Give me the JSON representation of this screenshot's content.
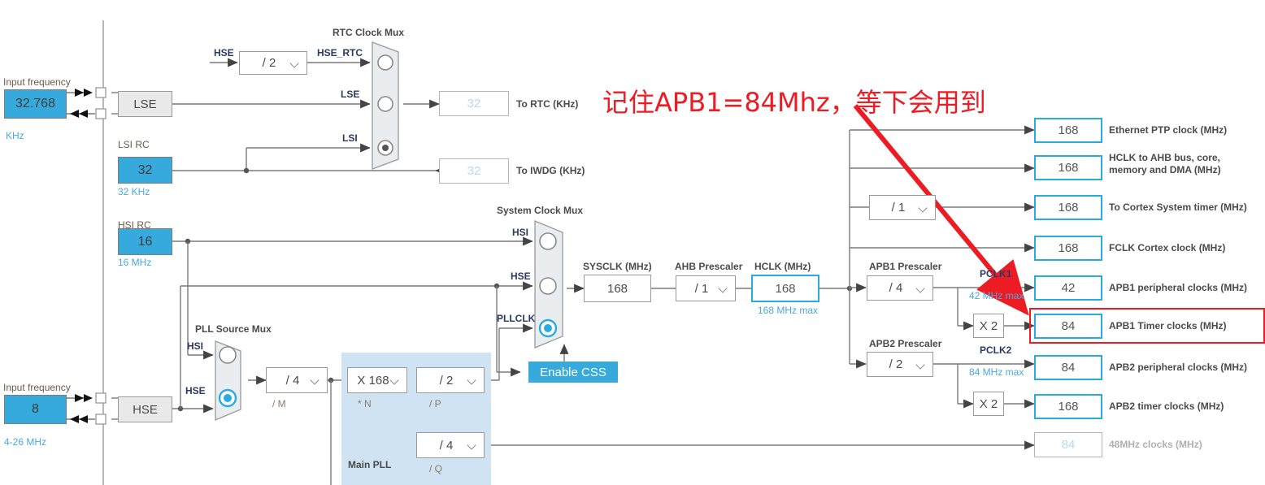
{
  "annotation": {
    "text": "记住APB1=84Mhz，等下会用到",
    "color": "#ED1C24"
  },
  "colors": {
    "accent_blue": "#29ABE2",
    "fill_blue": "#36A9DD",
    "pll_bg": "#cfe3f2",
    "red": "#ED1C24",
    "wire": "#7a7a7a"
  },
  "lse": {
    "input_caption": "Input frequency",
    "value": "32.768",
    "unit": "KHz",
    "osc_label": "LSE"
  },
  "lsi": {
    "caption": "LSI RC",
    "value": "32",
    "unit": "32 KHz"
  },
  "hsi": {
    "caption": "HSI RC",
    "value": "16",
    "unit": "16 MHz"
  },
  "hse": {
    "input_caption": "Input frequency",
    "value": "8",
    "unit": "4-26 MHz",
    "osc_label": "HSE"
  },
  "rtc_mux": {
    "title": "RTC Clock Mux",
    "inputs": [
      "HSE_RTC",
      "LSE",
      "LSI"
    ],
    "selected_index": 2,
    "hse_label": "HSE",
    "hse_div": "/ 2"
  },
  "rtc_outputs": [
    {
      "value": "32",
      "label": "To RTC (KHz)"
    },
    {
      "value": "32",
      "label": "To IWDG (KHz)"
    }
  ],
  "sysclk_mux": {
    "title": "System Clock Mux",
    "inputs": [
      "HSI",
      "HSE",
      "PLLCLK"
    ],
    "selected_index": 2,
    "css_button": "Enable CSS"
  },
  "pll_source_mux": {
    "title": "PLL Source Mux",
    "inputs": [
      "HSI",
      "HSE"
    ],
    "selected_index": 1
  },
  "pll": {
    "title": "Main PLL",
    "m": {
      "value": "/ 4",
      "label": "/ M"
    },
    "n": {
      "value": "X 168",
      "label": "* N"
    },
    "p": {
      "value": "/ 2",
      "label": "/ P"
    },
    "q": {
      "value": "/ 4",
      "label": "/ Q"
    }
  },
  "sysclk": {
    "label": "SYSCLK (MHz)",
    "value": "168"
  },
  "ahb_prescaler": {
    "label": "AHB Prescaler",
    "value": "/ 1"
  },
  "hclk": {
    "label": "HCLK (MHz)",
    "value": "168",
    "max": "168 MHz max"
  },
  "cortex_prescaler": {
    "value": "/ 1"
  },
  "apb1": {
    "label": "APB1 Prescaler",
    "value": "/ 4",
    "pclk_label": "PCLK1",
    "pclk_max": "42 MHz max",
    "timer_mult": "X 2"
  },
  "apb2": {
    "label": "APB2 Prescaler",
    "value": "/ 2",
    "pclk_label": "PCLK2",
    "pclk_max": "84 MHz max",
    "timer_mult": "X 2"
  },
  "outputs": [
    {
      "value": "168",
      "label": "Ethernet PTP clock (MHz)",
      "style": "blue",
      "highlight": false
    },
    {
      "value": "168",
      "label": "HCLK to AHB bus, core,\nmemory and DMA (MHz)",
      "style": "blue",
      "highlight": false
    },
    {
      "value": "168",
      "label": "To Cortex System timer (MHz)",
      "style": "blue",
      "highlight": false
    },
    {
      "value": "168",
      "label": "FCLK Cortex clock (MHz)",
      "style": "blue",
      "highlight": false
    },
    {
      "value": "42",
      "label": "APB1 peripheral clocks (MHz)",
      "style": "blue",
      "highlight": false
    },
    {
      "value": "84",
      "label": "APB1 Timer clocks (MHz)",
      "style": "blue",
      "highlight": true
    },
    {
      "value": "84",
      "label": "APB2 peripheral clocks (MHz)",
      "style": "blue",
      "highlight": false
    },
    {
      "value": "168",
      "label": "APB2 timer clocks (MHz)",
      "style": "blue",
      "highlight": false
    },
    {
      "value": "84",
      "label": "48MHz clocks (MHz)",
      "style": "dim",
      "highlight": false
    }
  ]
}
